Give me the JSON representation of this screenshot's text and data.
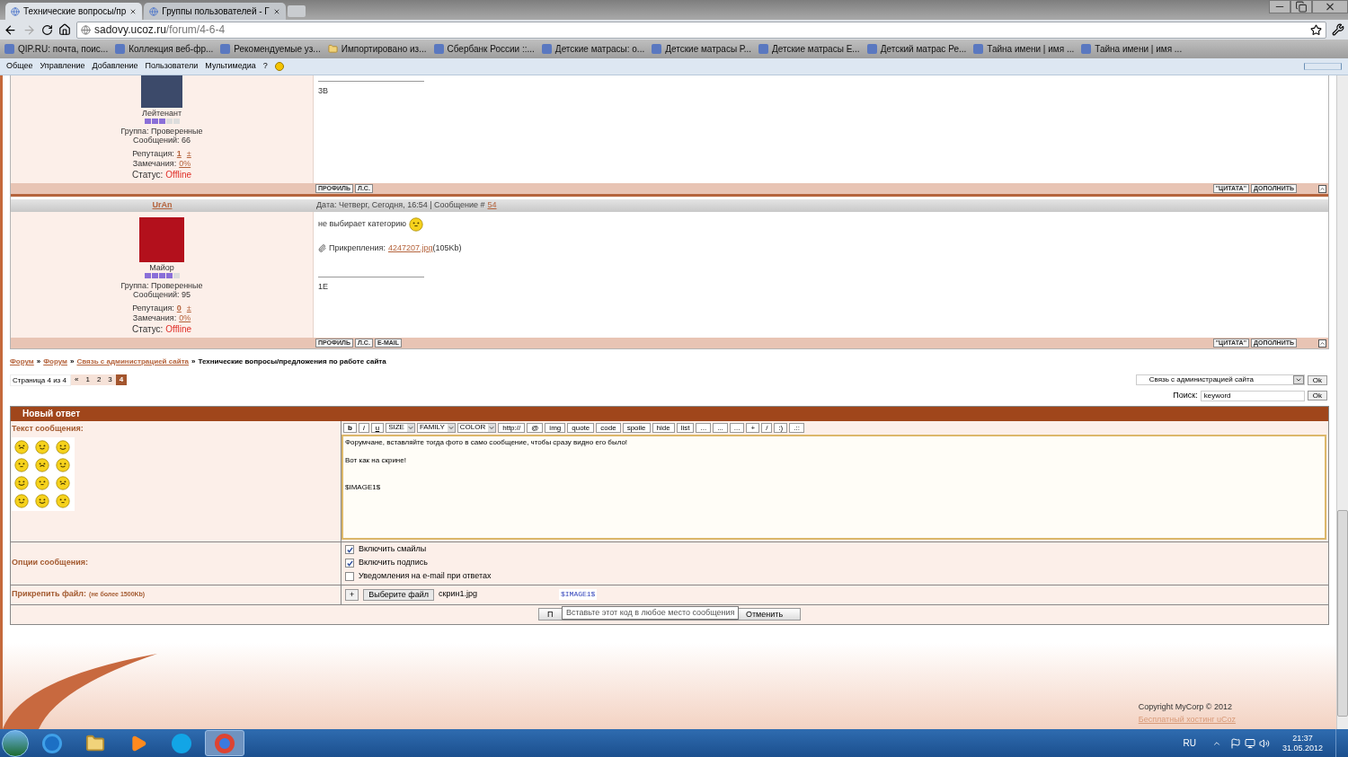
{
  "browser": {
    "tabs": [
      {
        "title": "Технические вопросы/пр",
        "selected": true
      },
      {
        "title": "Группы пользователей - Г",
        "selected": false
      }
    ],
    "address": {
      "host": "sadovy.ucoz.ru",
      "path": "/forum/4-6-4"
    },
    "bookmarks": [
      {
        "label": "QIP.RU: почта, поис...",
        "kind": "site"
      },
      {
        "label": "Коллекция веб-фр...",
        "kind": "site"
      },
      {
        "label": "Рекомендуемые уз...",
        "kind": "site"
      },
      {
        "label": "Импортировано из...",
        "kind": "folder"
      },
      {
        "label": "Сбербанк России ::...",
        "kind": "site"
      },
      {
        "label": "Детские матрасы: о...",
        "kind": "site"
      },
      {
        "label": "Детские матрасы Р...",
        "kind": "site"
      },
      {
        "label": "Детские матрасы Е...",
        "kind": "site"
      },
      {
        "label": "Детский матрас Ре...",
        "kind": "site"
      },
      {
        "label": "Тайна имени | имя ...",
        "kind": "site"
      },
      {
        "label": "Тайна имени | имя ...",
        "kind": "site"
      }
    ]
  },
  "admin_bar": {
    "items": [
      "Общее",
      "Управление",
      "Добавление",
      "Пользователи",
      "Мультимедиа",
      "?"
    ]
  },
  "posts": [
    {
      "rank": "Лейтенант",
      "stars": 3,
      "group": "Группа: Проверенные",
      "messages": "Сообщений: 66",
      "reputation_label": "Репутация:",
      "reputation": "1",
      "reputation_change": "±",
      "remarks_label": "Замечания:",
      "remarks": "0%",
      "status_label": "Статус:",
      "status": "Offline",
      "signature": "3B",
      "buttons": [
        "ПРОФИЛЬ",
        "Л.С."
      ],
      "actions": [
        "\"ЦИТАТА\"",
        "ДОПОЛНИТЬ"
      ]
    },
    {
      "author": "UrAn",
      "rank": "Майор",
      "stars": 4,
      "group": "Группа: Проверенные",
      "messages": "Сообщений: 95",
      "reputation_label": "Репутация:",
      "reputation": "0",
      "reputation_change": "±",
      "remarks_label": "Замечания:",
      "remarks": "0%",
      "status_label": "Статус:",
      "status": "Offline",
      "header": {
        "text": "Дата: Четверг, Сегодня, 16:54 | Сообщение #",
        "number": "54"
      },
      "body": [
        {
          "kind": "text",
          "text": "не выбирает категорию"
        },
        {
          "kind": "attachment",
          "label": "Прикрепления:",
          "link": "4247207.jpg",
          "size": "(105Kb)"
        }
      ],
      "signature": "1E",
      "buttons": [
        "ПРОФИЛЬ",
        "Л.С.",
        "E-MAIL"
      ],
      "actions": [
        "\"ЦИТАТА\"",
        "ДОПОЛНИТЬ"
      ]
    }
  ],
  "breadcrumbs": {
    "links": [
      "Форум",
      "Форум",
      "Связь с администрацией сайта"
    ],
    "separator": "»",
    "current": "Технические вопросы/предложения по работе сайта"
  },
  "pager": {
    "label": "Страница 4 из 4",
    "pages": [
      {
        "label": "«",
        "selected": false
      },
      {
        "label": "1",
        "selected": false
      },
      {
        "label": "2",
        "selected": false
      },
      {
        "label": "3",
        "selected": false
      },
      {
        "label": "4",
        "selected": true
      }
    ]
  },
  "jump": {
    "value": "Связь с администрацией сайта",
    "button": "Ok"
  },
  "search": {
    "label": "Поиск:",
    "value": "keyword",
    "button": "Ok"
  },
  "reply": {
    "title": "Новый ответ",
    "text_label": "Текст сообщения:",
    "toolbar": [
      {
        "label": "b",
        "kind": "button"
      },
      {
        "label": "i",
        "kind": "button"
      },
      {
        "label": "u",
        "kind": "button"
      },
      {
        "label": "SIZE",
        "kind": "select"
      },
      {
        "label": "FAMILY",
        "kind": "select"
      },
      {
        "label": "COLOR",
        "kind": "select"
      },
      {
        "label": "http://",
        "kind": "button"
      },
      {
        "label": "@",
        "kind": "button"
      },
      {
        "label": "img",
        "kind": "button"
      },
      {
        "label": "quote",
        "kind": "button"
      },
      {
        "label": "code",
        "kind": "button"
      },
      {
        "label": "spoile",
        "kind": "button"
      },
      {
        "label": "hide",
        "kind": "button"
      },
      {
        "label": "list",
        "kind": "button"
      },
      {
        "label": "...",
        "kind": "button"
      },
      {
        "label": "...",
        "kind": "button"
      },
      {
        "label": "...",
        "kind": "button"
      },
      {
        "label": "+",
        "kind": "button"
      },
      {
        "label": "/",
        "kind": "button"
      },
      {
        "label": ":)",
        "kind": "button"
      },
      {
        "label": ".::",
        "kind": "button"
      }
    ],
    "message": "Форумчане, вставляйте тогда фото в само сообщение, чтобы сразу видно его было!\n\nВот как на скрине!\n\n\n$IMAGE1$",
    "options_label": "Опции сообщения:",
    "options": [
      {
        "label": "Включить смайлы",
        "checked": true
      },
      {
        "label": "Включить подпись",
        "checked": true
      },
      {
        "label": "Уведомления на e-mail при ответах",
        "checked": false
      }
    ],
    "attach_label": "Прикрепить файл:",
    "attach_note": "(не более 1500Kb)",
    "add_button": "+",
    "choose_button": "Выберите файл",
    "file_name": "скрин1.jpg",
    "file_code": "$IMAGE1$",
    "submit": "П",
    "cancel": "Отменить",
    "tooltip": "Вставьте этот код в любое место сообщения"
  },
  "footer": {
    "copyright": "Copyright MyCorp © 2012",
    "hosting": "Бесплатный хостинг uCoz"
  },
  "taskbar": {
    "apps": [
      {
        "kind": "ie",
        "selected": false
      },
      {
        "kind": "folder",
        "selected": false
      },
      {
        "kind": "media",
        "selected": false
      },
      {
        "kind": "skype",
        "selected": false
      },
      {
        "kind": "chrome",
        "selected": true
      }
    ],
    "language": "RU",
    "time": "21:37",
    "date": "31.05.2012"
  }
}
